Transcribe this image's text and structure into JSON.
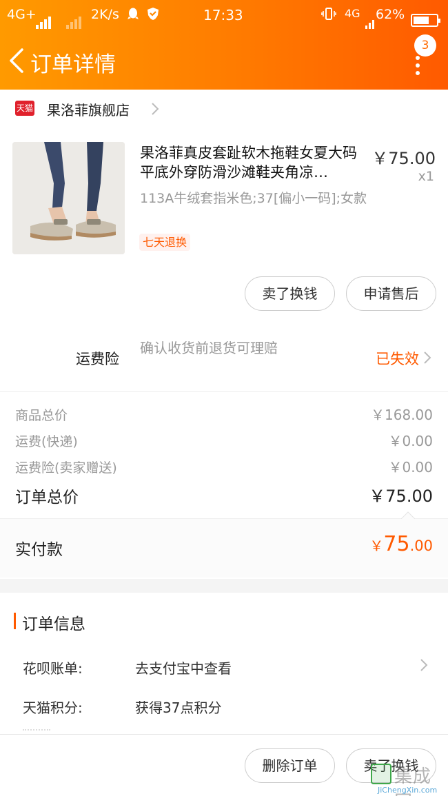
{
  "status_bar": {
    "network_left": "4G+",
    "speed": "2K/s",
    "time": "17:33",
    "network_right": "4G",
    "battery": "62%"
  },
  "nav": {
    "title": "订单详情",
    "badge_count": "3"
  },
  "shop": {
    "platform_badge": "天猫",
    "name": "果洛菲旗舰店"
  },
  "product": {
    "title": "果洛菲真皮套趾软木拖鞋女夏大码平底外穿防滑沙滩鞋夹角凉…",
    "price": "￥75.00",
    "qty": "x1",
    "sku": "113A牛绒套指米色;37[偏小一码];女款",
    "tag": "七天退换"
  },
  "actions": {
    "sell_button": "卖了换钱",
    "after_sale_button": "申请售后"
  },
  "insurance": {
    "label": "运费险",
    "description": "确认收货前退货可理赔",
    "status": "已失效"
  },
  "summary": {
    "rows": [
      {
        "label": "商品总价",
        "value": "￥168.00"
      },
      {
        "label": "运费(快递)",
        "value": "￥0.00"
      },
      {
        "label": "运费险(卖家赠送)",
        "value": "￥0.00"
      }
    ],
    "total_label": "订单总价",
    "total_value": "￥75.00",
    "paid_label": "实付款",
    "paid_symbol": "￥",
    "paid_int": "75",
    "paid_dec": ".00"
  },
  "order_info": {
    "section_title": "订单信息",
    "rows": [
      {
        "label": "花呗账单:",
        "value": "去支付宝中查看"
      },
      {
        "label": "天猫积分:",
        "value": "获得37点积分"
      }
    ]
  },
  "bottom": {
    "delete_button": "删除订单",
    "sell_button": "卖了换钱"
  },
  "watermark": {
    "text": "集成网",
    "sub": "JiChengXin.com"
  },
  "colors": {
    "accent": "#ff5a00",
    "header_start": "#ff9a00",
    "header_end": "#ff5a00",
    "tmall_red": "#e0212c"
  }
}
